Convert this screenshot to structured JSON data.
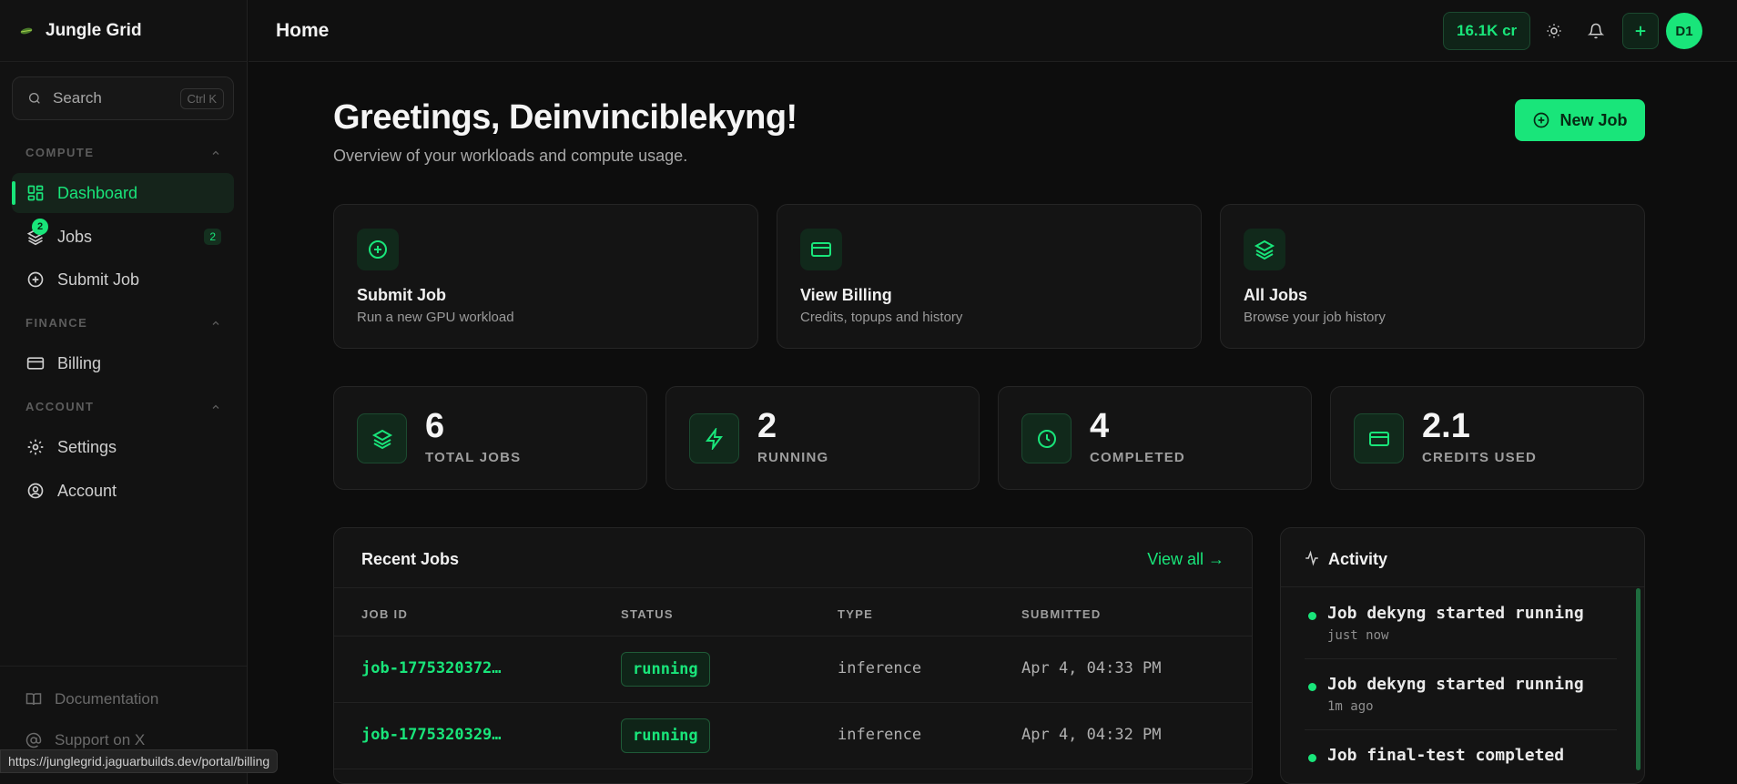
{
  "app": {
    "name": "Jungle Grid"
  },
  "sidebar": {
    "search_label": "Search",
    "search_shortcut": "Ctrl K",
    "sections": {
      "compute": "COMPUTE",
      "finance": "FINANCE",
      "account": "ACCOUNT"
    },
    "items": {
      "dashboard": "Dashboard",
      "jobs": "Jobs",
      "jobs_count": "2",
      "jobs_badge": "2",
      "submit_job": "Submit Job",
      "billing": "Billing",
      "settings": "Settings",
      "account": "Account"
    },
    "footer": {
      "documentation": "Documentation",
      "support": "Support on X"
    }
  },
  "status_url": "https://junglegrid.jaguarbuilds.dev/portal/billing",
  "header": {
    "title": "Home",
    "credits": "16.1K cr",
    "avatar_initials": "D1"
  },
  "main": {
    "greeting": "Greetings, Deinvinciblekyng!",
    "subtitle": "Overview of your workloads and compute usage.",
    "new_job_label": "New Job",
    "quick_actions": [
      {
        "title": "Submit Job",
        "desc": "Run a new GPU workload",
        "icon": "plus-circle-icon"
      },
      {
        "title": "View Billing",
        "desc": "Credits, topups and history",
        "icon": "credit-card-icon"
      },
      {
        "title": "All Jobs",
        "desc": "Browse your job history",
        "icon": "layers-icon"
      }
    ],
    "stats": [
      {
        "value": "6",
        "label": "TOTAL JOBS",
        "icon": "layers-icon"
      },
      {
        "value": "2",
        "label": "RUNNING",
        "icon": "zap-icon"
      },
      {
        "value": "4",
        "label": "COMPLETED",
        "icon": "clock-icon"
      },
      {
        "value": "2.1",
        "label": "CREDITS USED",
        "icon": "credit-card-icon"
      }
    ]
  },
  "recent_jobs": {
    "title": "Recent Jobs",
    "view_all": "View all →",
    "columns": [
      "JOB ID",
      "STATUS",
      "TYPE",
      "SUBMITTED"
    ],
    "rows": [
      {
        "id": "job-1775320372…",
        "status": "running",
        "type": "inference",
        "submitted": "Apr 4, 04:33 PM"
      },
      {
        "id": "job-1775320329…",
        "status": "running",
        "type": "inference",
        "submitted": "Apr 4, 04:32 PM"
      }
    ]
  },
  "activity": {
    "title": "Activity",
    "items": [
      {
        "text": "Job dekyng started running",
        "time": "just now"
      },
      {
        "text": "Job dekyng started running",
        "time": "1m ago"
      },
      {
        "text": "Job final-test completed",
        "time": ""
      }
    ]
  },
  "colors": {
    "accent": "#19e57a",
    "background": "#0d0d0d",
    "card": "#141414"
  }
}
